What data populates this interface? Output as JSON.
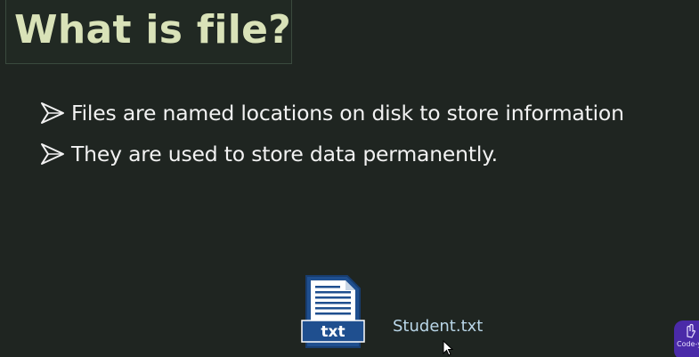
{
  "slide": {
    "title": "What is file?",
    "bullets": [
      "Files are named locations on disk to store information",
      "They are used to store data permanently."
    ],
    "file_icon_label": "txt",
    "file_name": "Student.txt",
    "corner_logo_text": "Code-y"
  },
  "colors": {
    "background": "#1f2521",
    "title": "#d9e2b8",
    "bullet_text": "#f2f2f2",
    "file_name": "#b9d6e8",
    "icon_blue": "#1f4f8f",
    "logo_purple": "#4a2aa8"
  },
  "icons": {
    "bullet": "arrowhead-bullet-icon",
    "file": "txt-file-icon",
    "cursor": "mouse-pointer-icon",
    "logo": "channel-logo-icon"
  }
}
